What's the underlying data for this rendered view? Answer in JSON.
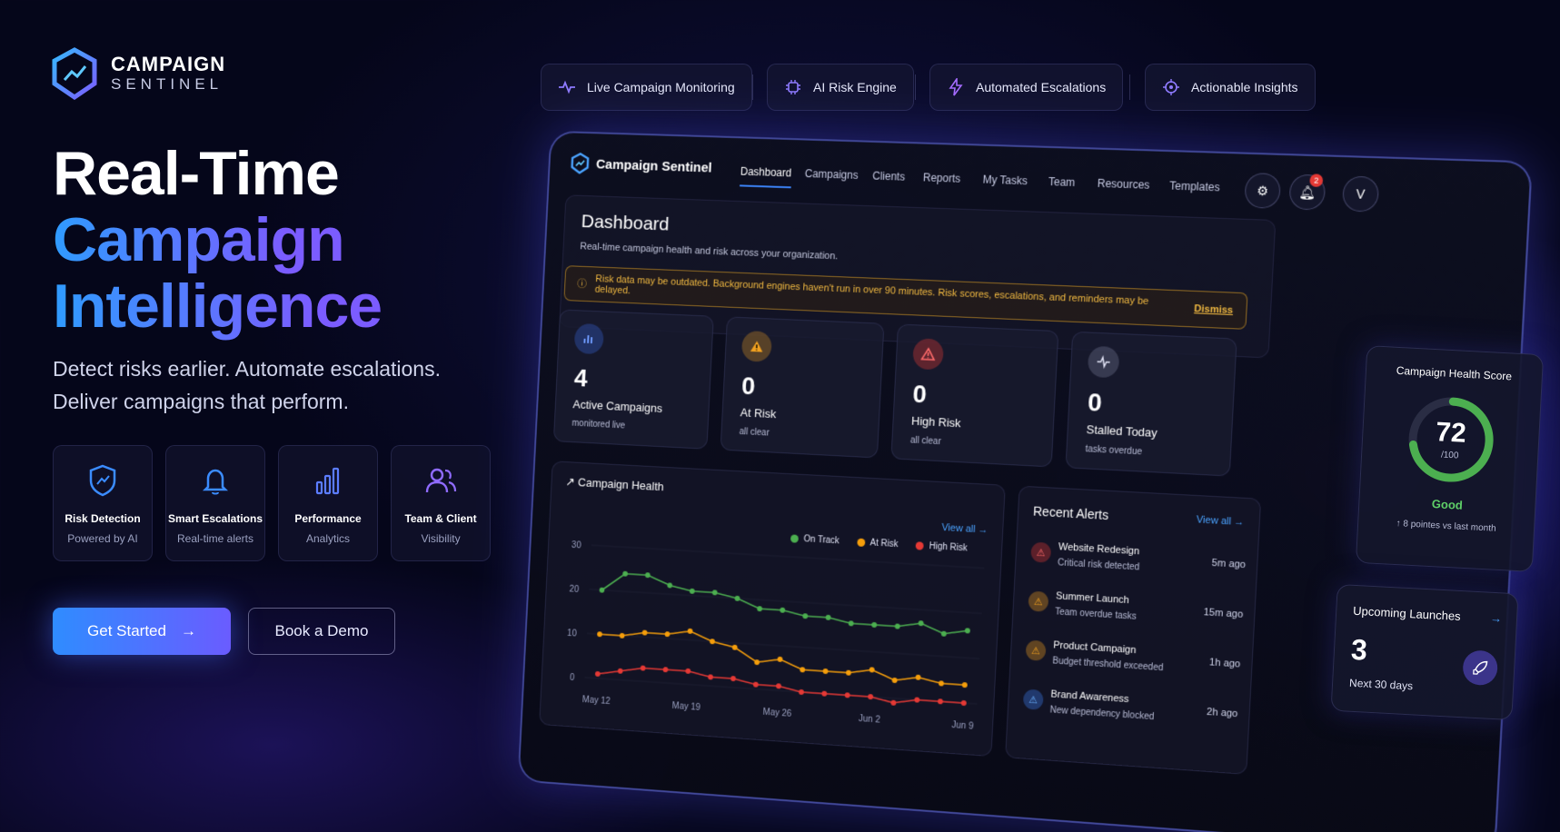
{
  "brand": {
    "line1": "CAMPAIGN",
    "line2": "SENTINEL"
  },
  "features_bar": [
    {
      "label": "Live Campaign Monitoring",
      "icon": "pulse-icon"
    },
    {
      "label": "AI Risk Engine",
      "icon": "chip-icon"
    },
    {
      "label": "Automated Escalations",
      "icon": "bolt-icon"
    },
    {
      "label": "Actionable Insights",
      "icon": "target-icon"
    }
  ],
  "hero": {
    "line1": "Real-Time",
    "line2": "Campaign",
    "line3": "Intelligence",
    "sub1": "Detect risks earlier. Automate escalations.",
    "sub2": "Deliver campaigns that perform."
  },
  "feature_cards": [
    {
      "title": "Risk Detection",
      "sub": "Powered by AI",
      "icon": "shield-icon"
    },
    {
      "title": "Smart Escalations",
      "sub": "Real-time alerts",
      "icon": "bell-icon"
    },
    {
      "title": "Performance",
      "sub": "Analytics",
      "icon": "bar-chart-icon"
    },
    {
      "title": "Team & Client",
      "sub": "Visibility",
      "icon": "users-icon"
    }
  ],
  "cta": {
    "primary": "Get Started",
    "secondary": "Book a Demo"
  },
  "app": {
    "brand": "Campaign Sentinel",
    "nav": [
      "Dashboard",
      "Campaigns",
      "Clients",
      "Reports",
      "My Tasks",
      "Team",
      "Resources",
      "Templates"
    ],
    "active_nav": "Dashboard",
    "notification_count": "2",
    "avatar": "V",
    "dashboard_title": "Dashboard",
    "dashboard_sub": "Real-time campaign health and risk across your organization.",
    "warning": "Risk data may be outdated. Background engines haven't run in over 90 minutes. Risk scores, escalations, and reminders may be delayed.",
    "dismiss": "Dismiss",
    "kpis": [
      {
        "value": "4",
        "label": "Active Campaigns",
        "sub": "monitored live",
        "icon": "bar-chart-icon",
        "color": "#3b6cf0"
      },
      {
        "value": "0",
        "label": "At Risk",
        "sub": "all clear",
        "icon": "warning-icon",
        "color": "#f0a020"
      },
      {
        "value": "0",
        "label": "High Risk",
        "sub": "all clear",
        "icon": "alert-icon",
        "color": "#e53935"
      },
      {
        "value": "0",
        "label": "Stalled Today",
        "sub": "tasks overdue",
        "icon": "pulse-icon",
        "color": "#9aa0c0"
      }
    ],
    "chart_title": "Campaign Health",
    "view_all": "View all",
    "alerts_title": "Recent Alerts",
    "alerts": [
      {
        "title": "Website Redesign",
        "sub": "Critical risk detected",
        "time": "5m ago",
        "color": "#e53935"
      },
      {
        "title": "Summer Launch",
        "sub": "Team overdue tasks",
        "time": "15m ago",
        "color": "#f0a020"
      },
      {
        "title": "Product Campaign",
        "sub": "Budget threshold exceeded",
        "time": "1h ago",
        "color": "#f0a020"
      },
      {
        "title": "Brand Awareness",
        "sub": "New dependency blocked",
        "time": "2h ago",
        "color": "#3b82f6"
      }
    ],
    "health": {
      "title": "Campaign Health Score",
      "score": "72",
      "of": "/100",
      "status": "Good",
      "delta": "↑ 8 pointes vs last month",
      "fraction": 0.72
    },
    "launch": {
      "title": "Upcoming Launches",
      "value": "3",
      "sub": "Next 30 days"
    }
  },
  "chart_data": {
    "type": "line",
    "x": [
      "May 12",
      "May 19",
      "May 26",
      "Jun 2",
      "Jun 9"
    ],
    "ylim": [
      0,
      30
    ],
    "yticks": [
      0,
      10,
      20,
      30
    ],
    "series": [
      {
        "name": "On Track",
        "color": "#4caf50",
        "values": [
          20,
          24,
          24,
          22,
          21,
          21,
          20,
          18,
          18,
          17,
          17,
          16,
          16,
          16,
          17,
          15,
          16
        ]
      },
      {
        "name": "At Risk",
        "color": "#f59e0b",
        "values": [
          10,
          10,
          11,
          11,
          12,
          10,
          9,
          6,
          7,
          5,
          5,
          5,
          6,
          4,
          5,
          4,
          4
        ]
      },
      {
        "name": "High Risk",
        "color": "#e53935",
        "values": [
          1,
          2,
          3,
          3,
          3,
          2,
          2,
          1,
          1,
          0,
          0,
          0,
          0,
          -1,
          0,
          0,
          0
        ]
      }
    ]
  }
}
